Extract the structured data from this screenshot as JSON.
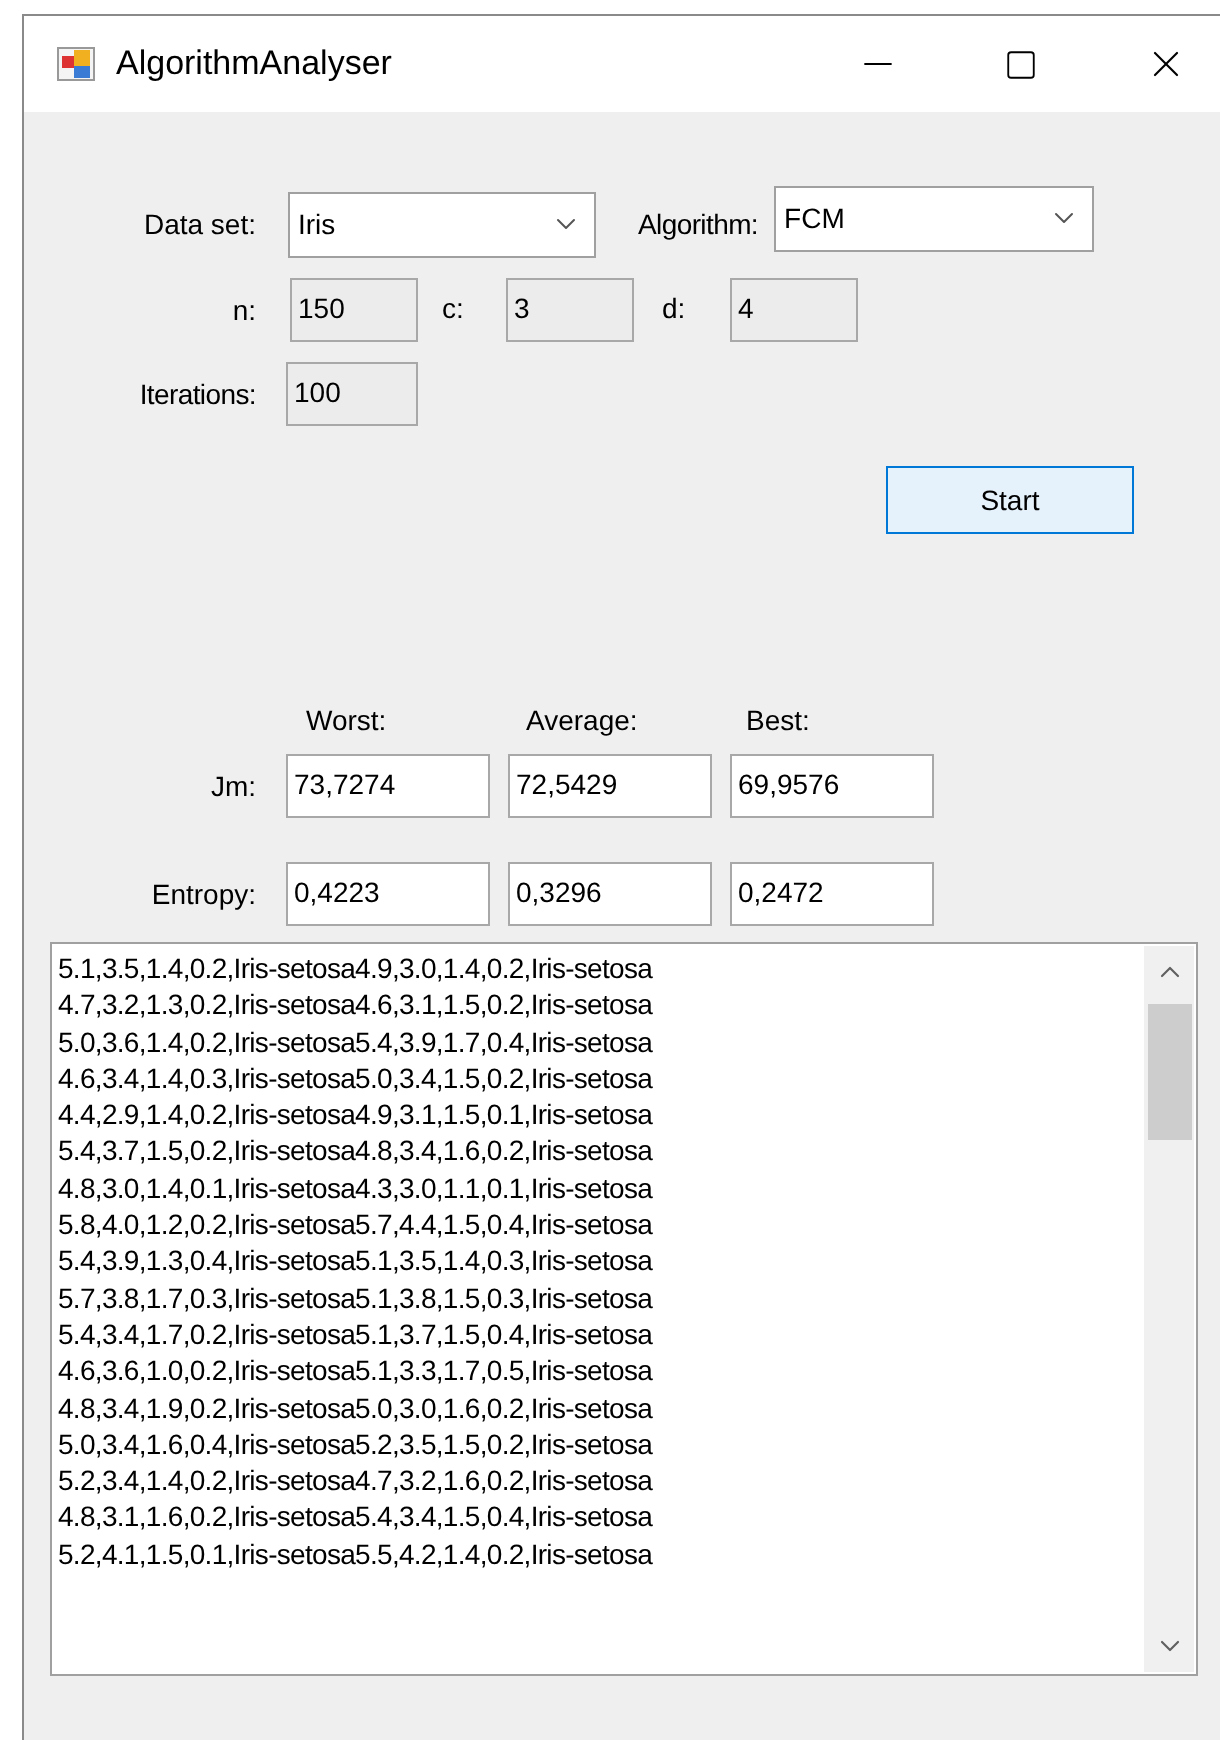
{
  "window": {
    "title": "AlgorithmAnalyser"
  },
  "data_set": {
    "label": "Data set:",
    "value": "Iris"
  },
  "algorithm": {
    "label": "Algorithm:",
    "value": "FCM"
  },
  "params": [
    {
      "label": "n:",
      "value": "150",
      "readonly": true
    },
    {
      "label": "c:",
      "value": "3",
      "readonly": true
    },
    {
      "label": "d:",
      "value": "4",
      "readonly": true
    }
  ],
  "iterations": {
    "label": "Iterations:",
    "value": "100",
    "readonly": true
  },
  "start_button": "Start",
  "results": {
    "columns": [
      "Worst:",
      "Average:",
      "Best:"
    ],
    "rows": [
      {
        "label": "Jm:",
        "values": [
          "73,7274",
          "72,5429",
          "69,9576"
        ],
        "readonly": false
      },
      {
        "label": "Entropy:",
        "values": [
          "0,4223",
          "0,3296",
          "0,2472"
        ],
        "readonly": false
      }
    ]
  },
  "output_lines": [
    "5.1,3.5,1.4,0.2,Iris-setosa4.9,3.0,1.4,0.2,Iris-setosa",
    "4.7,3.2,1.3,0.2,Iris-setosa4.6,3.1,1.5,0.2,Iris-setosa",
    "5.0,3.6,1.4,0.2,Iris-setosa5.4,3.9,1.7,0.4,Iris-setosa",
    "4.6,3.4,1.4,0.3,Iris-setosa5.0,3.4,1.5,0.2,Iris-setosa",
    "4.4,2.9,1.4,0.2,Iris-setosa4.9,3.1,1.5,0.1,Iris-setosa",
    "5.4,3.7,1.5,0.2,Iris-setosa4.8,3.4,1.6,0.2,Iris-setosa",
    "4.8,3.0,1.4,0.1,Iris-setosa4.3,3.0,1.1,0.1,Iris-setosa",
    "5.8,4.0,1.2,0.2,Iris-setosa5.7,4.4,1.5,0.4,Iris-setosa",
    "5.4,3.9,1.3,0.4,Iris-setosa5.1,3.5,1.4,0.3,Iris-setosa",
    "5.7,3.8,1.7,0.3,Iris-setosa5.1,3.8,1.5,0.3,Iris-setosa",
    "5.4,3.4,1.7,0.2,Iris-setosa5.1,3.7,1.5,0.4,Iris-setosa",
    "4.6,3.6,1.0,0.2,Iris-setosa5.1,3.3,1.7,0.5,Iris-setosa",
    "4.8,3.4,1.9,0.2,Iris-setosa5.0,3.0,1.6,0.2,Iris-setosa",
    "5.0,3.4,1.6,0.4,Iris-setosa5.2,3.5,1.5,0.2,Iris-setosa",
    "5.2,3.4,1.4,0.2,Iris-setosa4.7,3.2,1.6,0.2,Iris-setosa",
    "4.8,3.1,1.6,0.2,Iris-setosa5.4,3.4,1.5,0.4,Iris-setosa",
    "5.2,4.1,1.5,0.1,Iris-setosa5.5,4.2,1.4,0.2,Iris-setosa"
  ]
}
